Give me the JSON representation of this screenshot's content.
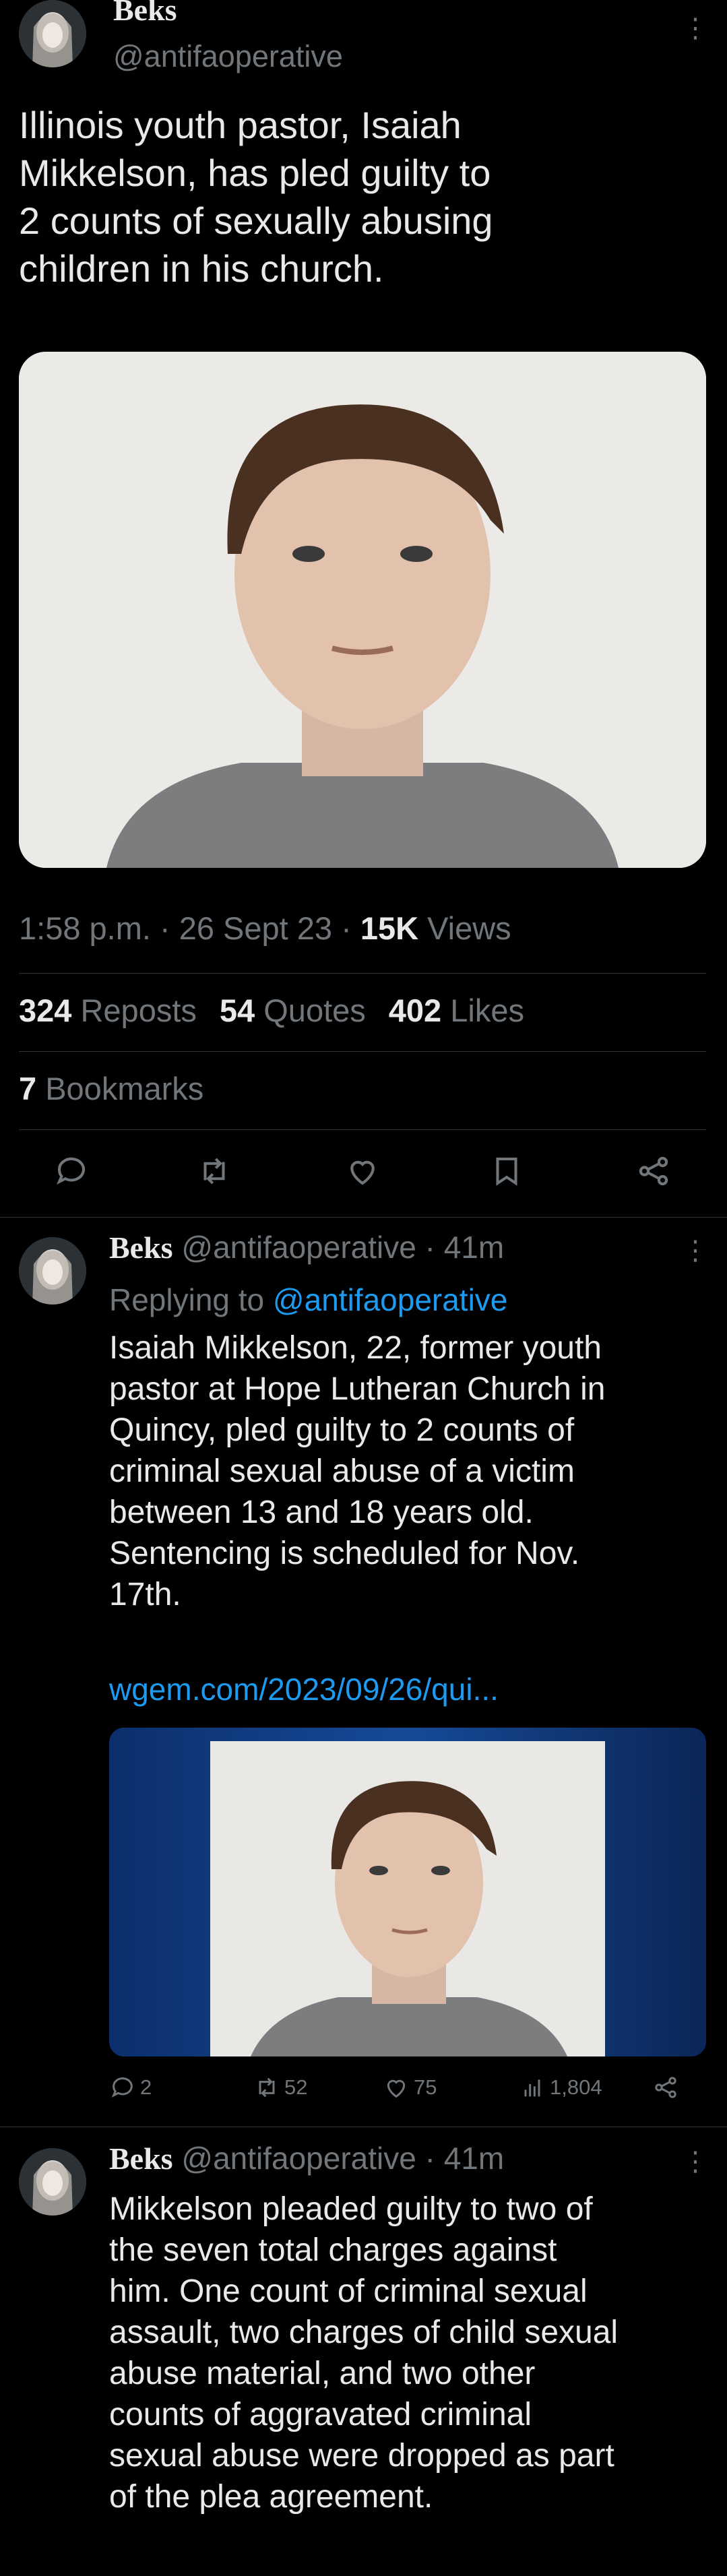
{
  "main_tweet": {
    "display_name": "Beks",
    "handle": "@antifaoperative",
    "text": "Illinois youth pastor, Isaiah\nMikkelson, has pled guilty to\n2 counts of sexually abusing\nchildren in his church.",
    "time": "1:58 p.m. · 26 Sept 23 · ",
    "views_count": "15K",
    "views_label": " Views",
    "reposts_count": "324",
    "reposts_label": " Reposts",
    "quotes_count": "54",
    "quotes_label": " Quotes",
    "likes_count": "402",
    "likes_label": " Likes",
    "bookmarks_count": "7",
    "bookmarks_label": " Bookmarks"
  },
  "reply1": {
    "display_name": "Beks",
    "handle": "@antifaoperative",
    "age": " · 41m",
    "replying_prefix": "Replying to ",
    "replying_handle": "@antifaoperative",
    "text": "Isaiah Mikkelson, 22, former youth\npastor at Hope Lutheran Church in\nQuincy, pled guilty to 2 counts of\ncriminal sexual abuse of a victim\nbetween 13 and 18 years old.\nSentencing is scheduled for Nov.\n17th.",
    "link": "wgem.com/2023/09/26/qui...",
    "replies": "2",
    "reposts": "52",
    "likes": "75",
    "views": "1,804"
  },
  "reply2": {
    "display_name": "Beks",
    "handle": "@antifaoperative",
    "age": " · 41m",
    "text": "Mikkelson pleaded guilty to two of\nthe seven total charges against\nhim. One count of criminal sexual\nassault, two charges of child sexual\nabuse material, and two other\ncounts of aggravated criminal\nsexual abuse were dropped as part\nof the plea agreement."
  },
  "colors": {
    "background": "#000000",
    "text": "#e7e9ea",
    "muted": "#71767b",
    "accent": "#1d9bf0",
    "divider": "#2f3336"
  }
}
